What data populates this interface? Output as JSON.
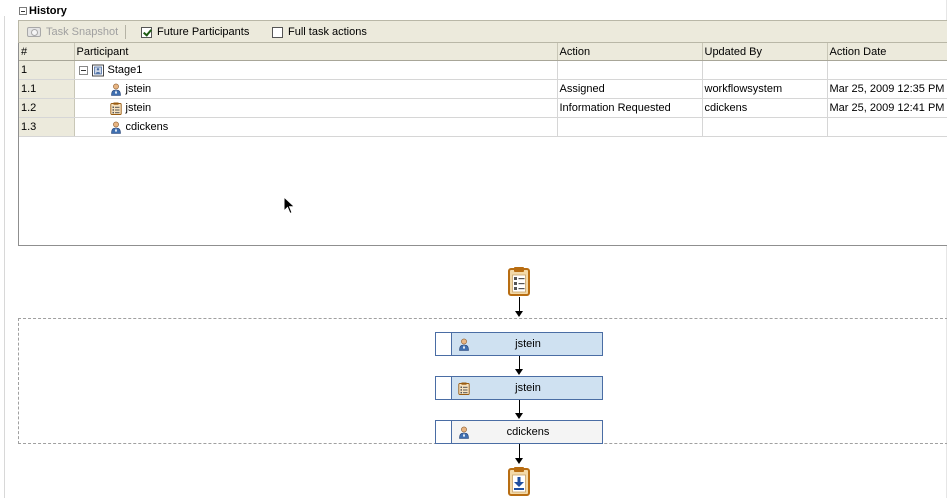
{
  "panel": {
    "title": "History"
  },
  "toolbar": {
    "snapshot_label": "Task Snapshot",
    "future_label": "Future Participants",
    "future_checked": true,
    "full_label": "Full task actions",
    "full_checked": false
  },
  "table": {
    "columns": [
      "#",
      "Participant",
      "Action",
      "Updated By",
      "Action Date"
    ],
    "rows": [
      {
        "num": "1",
        "participant": "Stage1",
        "icon": "stage-icon",
        "action": "",
        "updated_by": "",
        "date": ""
      },
      {
        "num": "1.1",
        "participant": "jstein",
        "icon": "user-icon",
        "action": "Assigned",
        "updated_by": "workflowsystem",
        "date": "Mar 25, 2009 12:35 PM"
      },
      {
        "num": "1.2",
        "participant": "jstein",
        "icon": "task-list-icon",
        "action": "Information Requested",
        "updated_by": "cdickens",
        "date": "Mar 25, 2009 12:41 PM"
      },
      {
        "num": "1.3",
        "participant": "cdickens",
        "icon": "user-icon",
        "action": "",
        "updated_by": "",
        "date": ""
      }
    ]
  },
  "diagram": {
    "nodes": [
      {
        "label": "jstein",
        "icon": "user-icon",
        "style": "blue"
      },
      {
        "label": "jstein",
        "icon": "task-list-icon",
        "style": "blue"
      },
      {
        "label": "cdickens",
        "icon": "user-icon",
        "style": "white"
      }
    ],
    "start_icon": "clipboard-icon",
    "end_icon": "download-icon"
  },
  "colors": {
    "toolbar_bg": "#eceadc",
    "node_blue": "#cfe1f1",
    "node_border": "#4a6da4",
    "clipboard_orange": "#c87a1e"
  }
}
